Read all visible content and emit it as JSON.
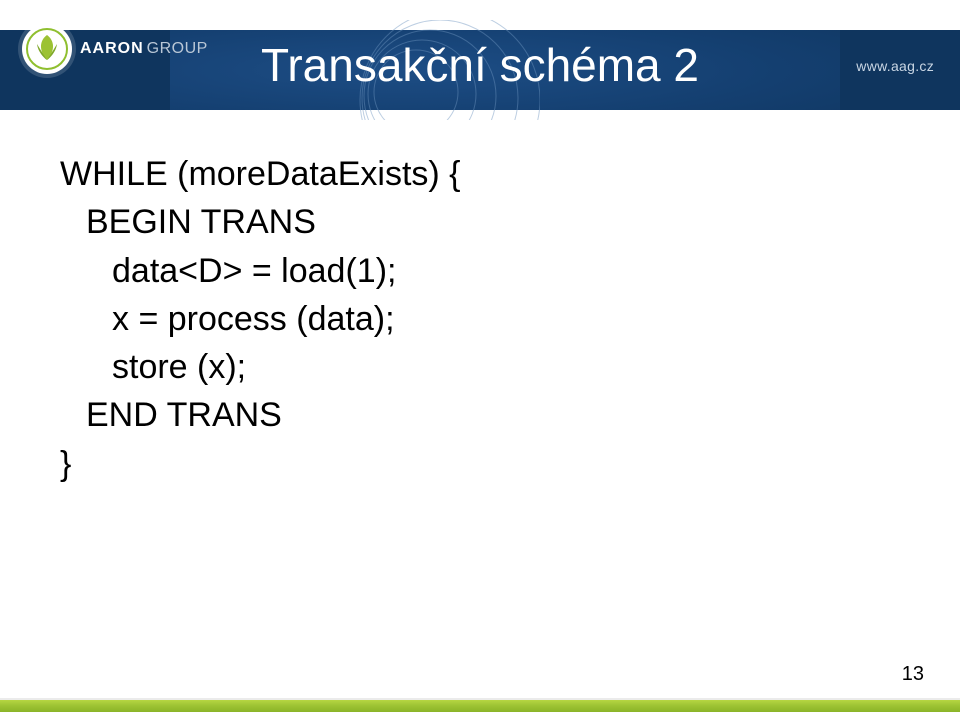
{
  "header": {
    "title": "Transakční schéma 2",
    "brand_primary": "AARON",
    "brand_secondary": "GROUP",
    "url": "www.aag.cz"
  },
  "code": {
    "l1": "WHILE (moreDataExists) {",
    "l2": "BEGIN TRANS",
    "l3": "data<D> = load(1);",
    "l4": "x = process (data);",
    "l5": "store (x);",
    "l6": "END TRANS",
    "l7": "}"
  },
  "page_number": "13",
  "colors": {
    "header_bg": "#0f355e",
    "accent_green": "#9cc233"
  }
}
